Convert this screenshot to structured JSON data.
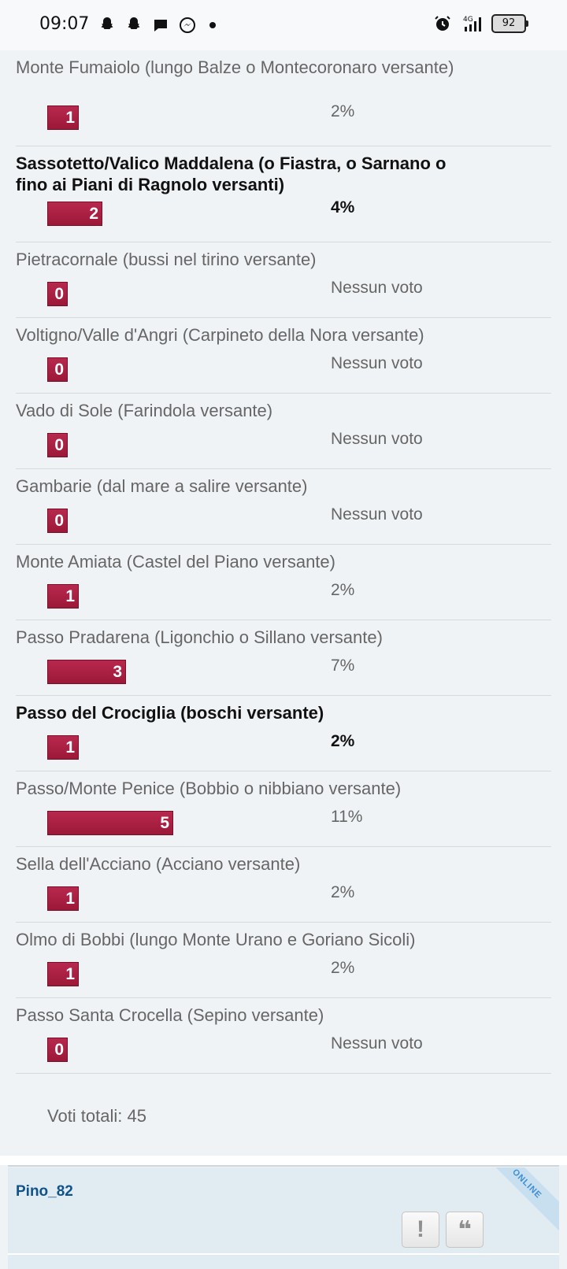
{
  "status_bar": {
    "time": "09:07",
    "left_icons": [
      "snapchat-icon",
      "snapchat-icon",
      "chat-bubble-icon",
      "messenger-icon",
      "dot-icon"
    ],
    "network": "4G",
    "battery": "92"
  },
  "poll": {
    "options": [
      {
        "label": "Monte Fumaiolo (lungo Balze o Montecoronaro versante)",
        "votes": "1",
        "percent": "2%",
        "bold": false,
        "tall": true
      },
      {
        "label": "Sassotetto/Valico Maddalena (o Fiastra, o Sarnano o fino ai Piani di Ragnolo versanti)",
        "votes": "2",
        "percent": "4%",
        "bold": true,
        "tall": true
      },
      {
        "label": "Pietracornale (bussi nel tirino versante)",
        "votes": "0",
        "percent": "Nessun voto",
        "bold": false
      },
      {
        "label": "Voltigno/Valle d'Angri (Carpineto della Nora versante)",
        "votes": "0",
        "percent": "Nessun voto",
        "bold": false
      },
      {
        "label": "Vado di Sole (Farindola versante)",
        "votes": "0",
        "percent": "Nessun voto",
        "bold": false
      },
      {
        "label": "Gambarie (dal mare a salire versante)",
        "votes": "0",
        "percent": "Nessun voto",
        "bold": false
      },
      {
        "label": "Monte Amiata (Castel del Piano versante)",
        "votes": "1",
        "percent": "2%",
        "bold": false
      },
      {
        "label": "Passo Pradarena (Ligonchio o Sillano versante)",
        "votes": "3",
        "percent": "7%",
        "bold": false
      },
      {
        "label": "Passo del Crociglia (boschi versante)",
        "votes": "1",
        "percent": "2%",
        "bold": true
      },
      {
        "label": "Passo/Monte Penice (Bobbio o nibbiano versante)",
        "votes": "5",
        "percent": "11%",
        "bold": false
      },
      {
        "label": "Sella dell'Acciano (Acciano versante)",
        "votes": "1",
        "percent": "2%",
        "bold": false
      },
      {
        "label": "Olmo di Bobbi (lungo Monte Urano e Goriano Sicoli)",
        "votes": "1",
        "percent": "2%",
        "bold": false
      },
      {
        "label": "Passo Santa Crocella (Sepino versante)",
        "votes": "0",
        "percent": "Nessun voto",
        "bold": false
      }
    ],
    "total_label": "Voti totali: 45",
    "bar_color": "#a81e42"
  },
  "post_footer": {
    "username": "Pino_82",
    "report_icon": "exclamation-icon",
    "quote_icon": "quote-icon",
    "report_glyph": "!",
    "quote_glyph": "❝",
    "online_badge": "ONLINE"
  }
}
